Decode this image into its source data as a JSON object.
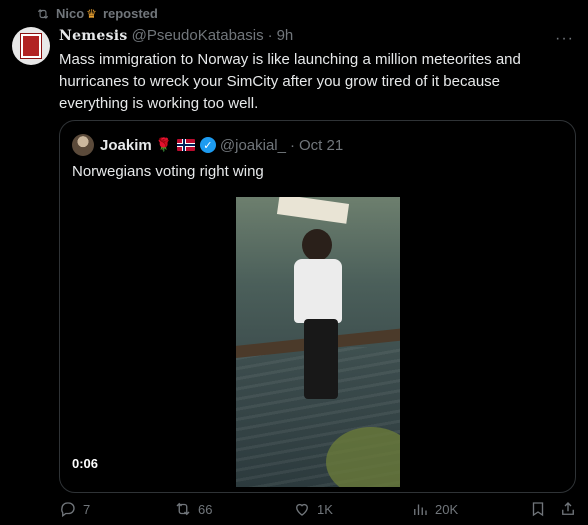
{
  "repost": {
    "user": "Nico",
    "label": "reposted"
  },
  "post": {
    "author_name": "Nemesis",
    "author_handle": "@PseudoKatabasis",
    "separator": "·",
    "time": "9h",
    "text": "Mass immigration to Norway is like launching a million meteorites and hurricanes to wreck your SimCity after you grow tired of it because everything is working too well."
  },
  "quote": {
    "author_name": "Joakim",
    "author_handle": "@joakial_",
    "separator": "·",
    "time": "Oct 21",
    "text": "Norwegians voting right wing",
    "video_duration": "0:06"
  },
  "actions": {
    "replies": "7",
    "reposts": "66",
    "likes": "1K",
    "views": "20K"
  },
  "colors": {
    "background": "#000000",
    "text": "#e7e9ea",
    "muted": "#71767b",
    "border": "#2f3336",
    "verified": "#1d9bf0"
  }
}
